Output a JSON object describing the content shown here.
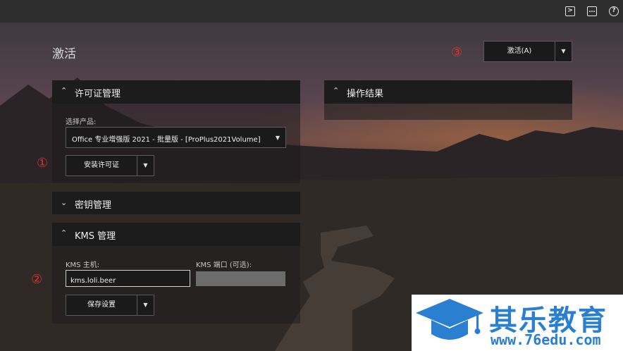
{
  "page": {
    "title": "激活"
  },
  "markers": [
    "①",
    "②",
    "③"
  ],
  "topbar": {
    "icons": [
      "terminal-icon",
      "feedback-icon",
      "help-icon"
    ]
  },
  "activate_button": {
    "label": "激活(A)"
  },
  "license_panel": {
    "title": "许可证管理",
    "product_label": "选择产品:",
    "product_value": "Office 专业增强版 2021 - 批量版 - [ProPlus2021Volume]",
    "install_button": "安装许可证"
  },
  "result_panel": {
    "title": "操作结果"
  },
  "key_panel": {
    "title": "密钥管理"
  },
  "kms_panel": {
    "title": "KMS 管理",
    "host_label": "KMS 主机:",
    "host_value": "kms.loli.beer",
    "port_label": "KMS 端口 (可选):",
    "port_value": "",
    "save_button": "保存设置"
  },
  "watermark": {
    "text": "其乐教育",
    "url": "www.76edu.com"
  },
  "colors": {
    "accent": "#2a7fd0",
    "marker": "#e03030",
    "panel_header": "#1c1c1c"
  }
}
